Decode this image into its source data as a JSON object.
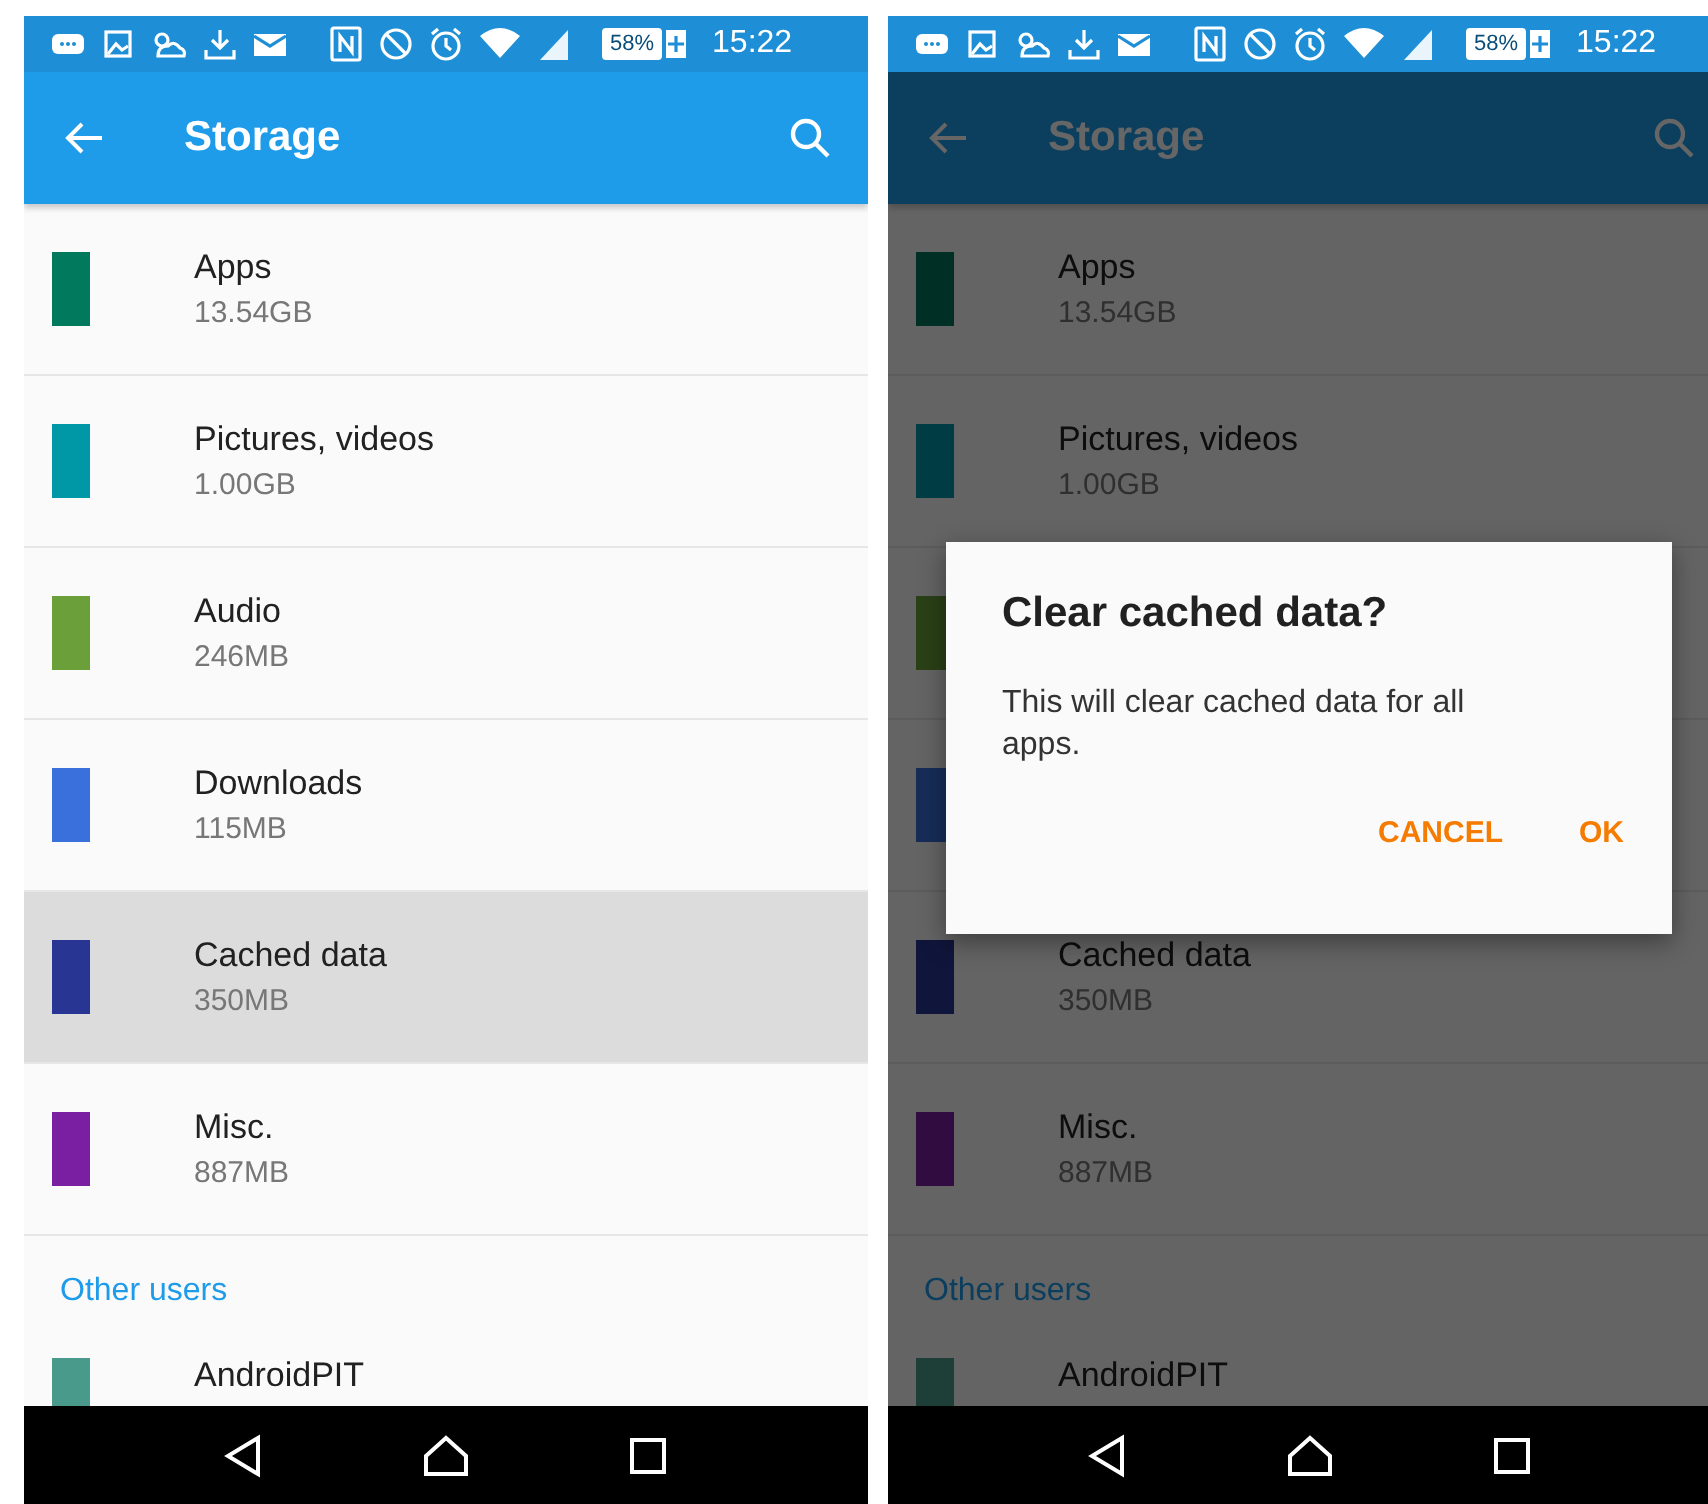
{
  "screens": [
    {
      "status_bar": {
        "battery": "58%",
        "time": "15:22"
      },
      "app_bar": {
        "title": "Storage"
      },
      "items": [
        {
          "label": "Apps",
          "size": "13.54GB",
          "color": "#00795c",
          "selected": false
        },
        {
          "label": "Pictures, videos",
          "size": "1.00GB",
          "color": "#0097a7",
          "selected": false
        },
        {
          "label": "Audio",
          "size": "246MB",
          "color": "#6a9f3a",
          "selected": false
        },
        {
          "label": "Downloads",
          "size": "115MB",
          "color": "#3a70db",
          "selected": false
        },
        {
          "label": "Cached data",
          "size": "350MB",
          "color": "#283593",
          "selected": true
        },
        {
          "label": "Misc.",
          "size": "887MB",
          "color": "#7b1fa2",
          "selected": false
        }
      ],
      "section_header": "Other users",
      "users": [
        {
          "name": "AndroidPIT",
          "color": "#4a9a8c"
        }
      ]
    },
    {
      "status_bar": {
        "battery": "58%",
        "time": "15:22"
      },
      "app_bar": {
        "title": "Storage"
      },
      "items": [
        {
          "label": "Apps",
          "size": "13.54GB",
          "color": "#003025",
          "selected": false
        },
        {
          "label": "Pictures, videos",
          "size": "1.00GB",
          "color": "#003c43",
          "selected": false
        },
        {
          "color": "#2a4017",
          "selected": false
        },
        {
          "color": "#172d58",
          "selected": false
        },
        {
          "label": "Cached data",
          "size": "350MB",
          "color": "#10153b",
          "selected": false
        },
        {
          "label": "Misc.",
          "size": "887MB",
          "color": "#310c41",
          "selected": false
        }
      ],
      "section_header": "Other users",
      "users": [
        {
          "name": "AndroidPIT",
          "color": "#1e3e38"
        }
      ],
      "dialog": {
        "title": "Clear cached data?",
        "message": "This will clear cached data for all apps.",
        "buttons": [
          "CANCEL",
          "OK"
        ]
      }
    }
  ]
}
